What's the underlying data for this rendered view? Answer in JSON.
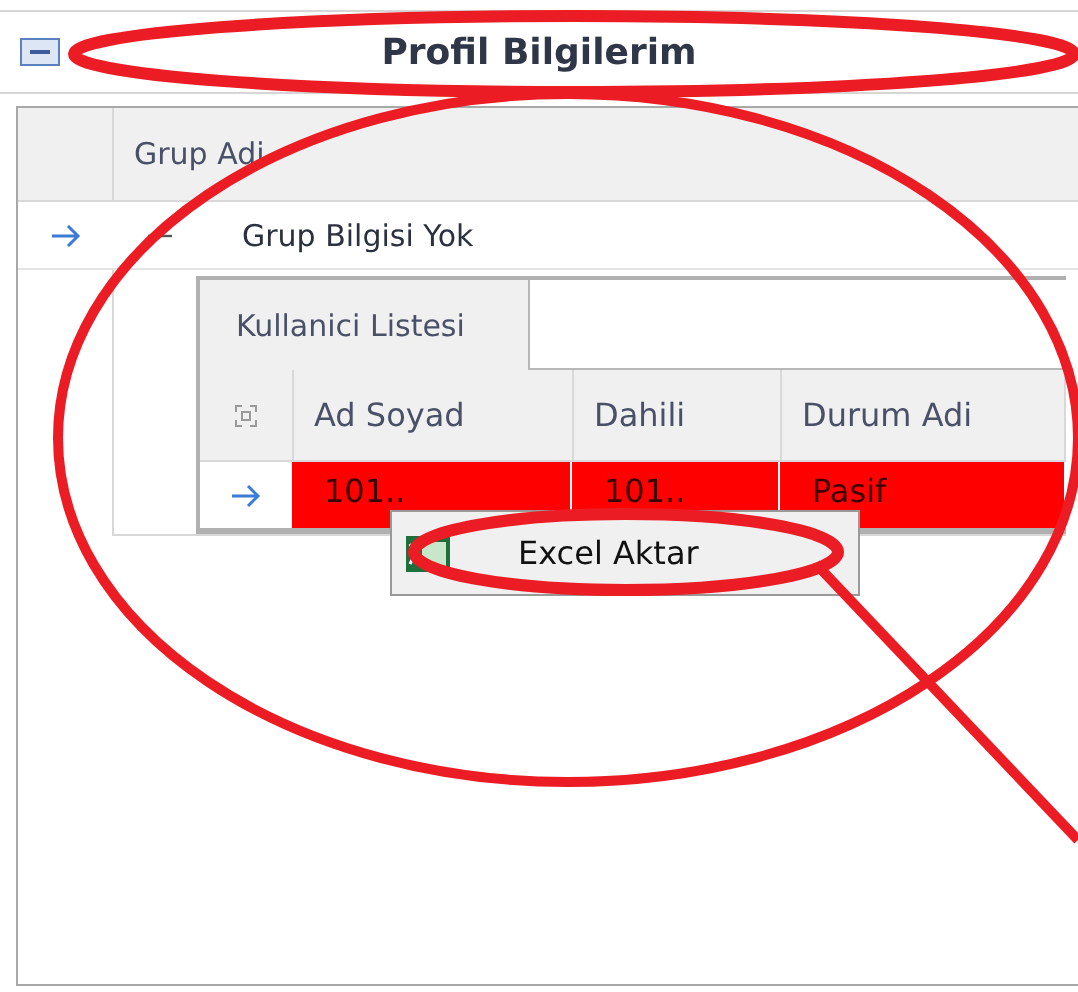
{
  "panel": {
    "title": "Profil Bilgilerim"
  },
  "grid": {
    "columns": [
      "Grup Adi"
    ],
    "rows": [
      {
        "current": true,
        "expanded": true,
        "cells": [
          "Grup Bilgisi Yok"
        ],
        "detail": {
          "tabs": [
            {
              "label": "Kullanici Listesi",
              "selected": true
            }
          ],
          "columns": [
            "Ad Soyad",
            "Dahili",
            "Durum Adi"
          ],
          "rows": [
            {
              "current": true,
              "highlighted": true,
              "cells": [
                "101..",
                "101..",
                "Pasif"
              ]
            }
          ]
        }
      }
    ]
  },
  "context_menu": {
    "items": [
      {
        "label": "Excel Aktar"
      }
    ]
  }
}
